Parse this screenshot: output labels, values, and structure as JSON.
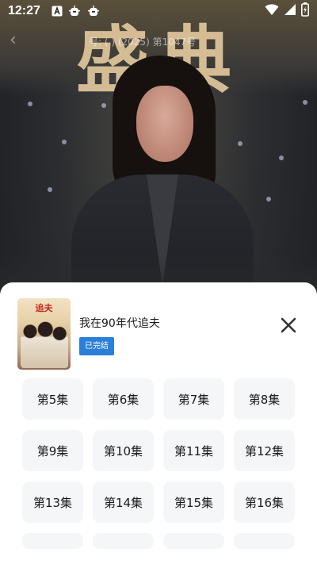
{
  "status_bar": {
    "time": "12:27",
    "icons": [
      "a-app-icon",
      "bug-icon",
      "bug-icon"
    ],
    "right_icons": [
      "wifi-icon",
      "signal-icon",
      "battery-charging-icon"
    ]
  },
  "video": {
    "banner_text": "盛典",
    "watermark": "号: (    )   (2025) 第1047号"
  },
  "sheet": {
    "drama_title": "我在90年代追夫",
    "cover_title": "追夫",
    "status_tag": "已完结",
    "episodes": [
      "第5集",
      "第6集",
      "第7集",
      "第8集",
      "第9集",
      "第10集",
      "第11集",
      "第12集",
      "第13集",
      "第14集",
      "第15集",
      "第16集"
    ]
  },
  "colors": {
    "tag_blue": "#2a7fd9",
    "episode_bg": "#f5f6f8",
    "sheet_bg": "#ffffff"
  }
}
